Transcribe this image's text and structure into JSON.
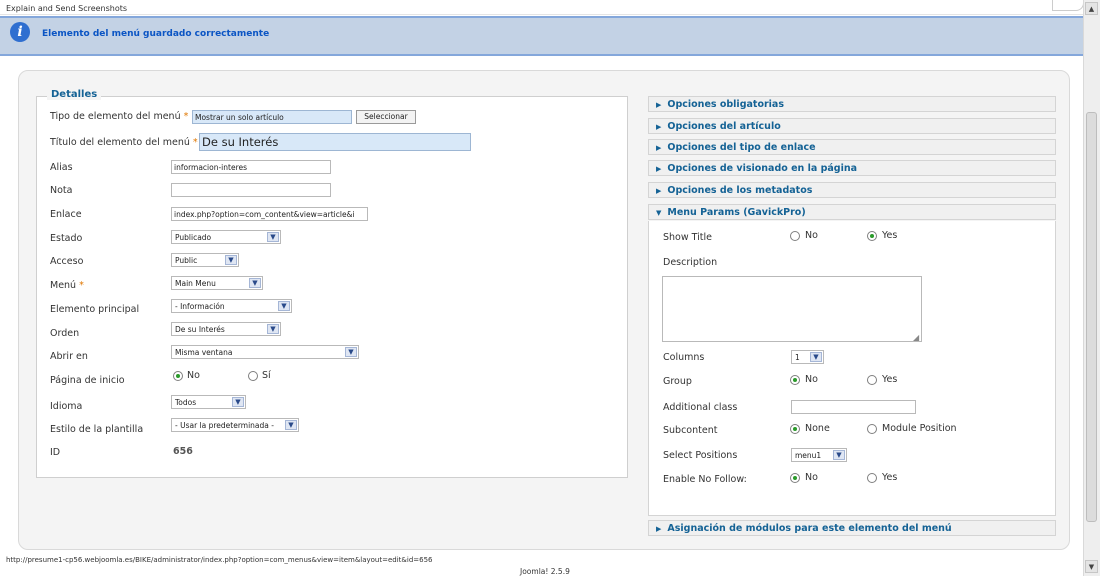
{
  "top": {
    "explain_link": "Explain and Send Screenshots"
  },
  "message": {
    "text": "Elemento del menú guardado correctamente",
    "icon": "info-icon"
  },
  "details": {
    "legend": "Detalles",
    "fields": {
      "tipo": {
        "label": "Tipo de elemento del menú",
        "value": "Mostrar un solo artículo",
        "button": "Seleccionar"
      },
      "titulo": {
        "label": "Título del elemento del menú",
        "value": "De su Interés"
      },
      "alias": {
        "label": "Alias",
        "value": "informacion-interes"
      },
      "nota": {
        "label": "Nota",
        "value": ""
      },
      "enlace": {
        "label": "Enlace",
        "value": "index.php?option=com_content&view=article&i"
      },
      "estado": {
        "label": "Estado",
        "value": "Publicado"
      },
      "acceso": {
        "label": "Acceso",
        "value": "Public"
      },
      "menu": {
        "label": "Menú",
        "value": "Main Menu"
      },
      "principal": {
        "label": "Elemento principal",
        "value": "- Información"
      },
      "orden": {
        "label": "Orden",
        "value": "De su Interés"
      },
      "abrir": {
        "label": "Abrir en",
        "value": "Misma ventana"
      },
      "inicio": {
        "label": "Página de inicio",
        "opt_no": "No",
        "opt_si": "Sí",
        "selected": "No"
      },
      "idioma": {
        "label": "Idioma",
        "value": "Todos"
      },
      "estilo": {
        "label": "Estilo de la plantilla",
        "value": "- Usar la predeterminada -"
      },
      "id": {
        "label": "ID",
        "value": "656"
      }
    },
    "required_mark": "*"
  },
  "accordion": {
    "obligatorias": "Opciones obligatorias",
    "articulo": "Opciones del artículo",
    "tipo_enlace": "Opciones del tipo de enlace",
    "visionado": "Opciones de visionado en la página",
    "metadatos": "Opciones de los metadatos",
    "gavick": "Menu Params (GavickPro)",
    "asignacion": "Asignación de módulos para este elemento del menú"
  },
  "gavick": {
    "show_title": {
      "label": "Show Title",
      "opt_no": "No",
      "opt_yes": "Yes",
      "selected": "Yes"
    },
    "description": {
      "label": "Description",
      "value": ""
    },
    "columns": {
      "label": "Columns",
      "value": "1"
    },
    "group": {
      "label": "Group",
      "opt_no": "No",
      "opt_yes": "Yes",
      "selected": "No"
    },
    "additional_class": {
      "label": "Additional class",
      "value": ""
    },
    "subcontent": {
      "label": "Subcontent",
      "opt_none": "None",
      "opt_module": "Module Position",
      "selected": "None"
    },
    "select_positions": {
      "label": "Select Positions",
      "value": "menu1"
    },
    "no_follow": {
      "label": "Enable No Follow:",
      "opt_no": "No",
      "opt_yes": "Yes",
      "selected": "No"
    }
  },
  "status": {
    "url": "http://presume1-cp56.webjoomla.es/BIKE/administrator/index.php?option=com_menus&view=item&layout=edit&id=656",
    "version": "Joomla! 2.5.9"
  },
  "colors": {
    "message_bg": "#c3d2e5",
    "link_blue": "#146295",
    "accent_blue": "#0b55c4"
  }
}
